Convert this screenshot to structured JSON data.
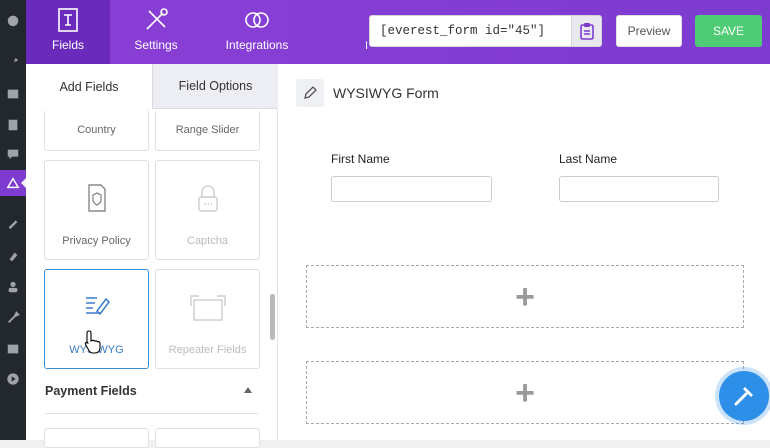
{
  "wp_sidebar": {
    "icons": [
      "dashboard-icon",
      "pin-icon",
      "media-icon",
      "pages-icon",
      "comments-icon",
      "everest-forms-icon",
      "brush-icon",
      "plugin-icon",
      "users-icon",
      "tools-icon",
      "settings-icon",
      "play-icon"
    ]
  },
  "header": {
    "nav": [
      {
        "label": "Fields",
        "icon": "fields-icon",
        "active": true
      },
      {
        "label": "Settings",
        "icon": "settings-tools-icon"
      },
      {
        "label": "Integrations",
        "icon": "integrations-icon"
      }
    ],
    "partial_tab": "I",
    "shortcode": "[everest_form id=\"45\"]",
    "preview_label": "Preview",
    "save_label": "SAVE"
  },
  "panel": {
    "tabs": {
      "add": "Add Fields",
      "options": "Field Options"
    },
    "fields": [
      {
        "label": "Country"
      },
      {
        "label": "Range Slider"
      },
      {
        "label": "Privacy Policy"
      },
      {
        "label": "Captcha",
        "disabled": true
      },
      {
        "label": "WYSIWYG",
        "selected": true
      },
      {
        "label": "Repeater Fields",
        "disabled": true
      }
    ],
    "section": "Payment Fields"
  },
  "builder": {
    "form_title": "WYSIWYG Form",
    "first_name_label": "First Name",
    "last_name_label": "Last Name",
    "plus": "+"
  },
  "colors": {
    "brand": "#7e3bd0",
    "save": "#4fcb75",
    "accent": "#2e8fe8"
  }
}
